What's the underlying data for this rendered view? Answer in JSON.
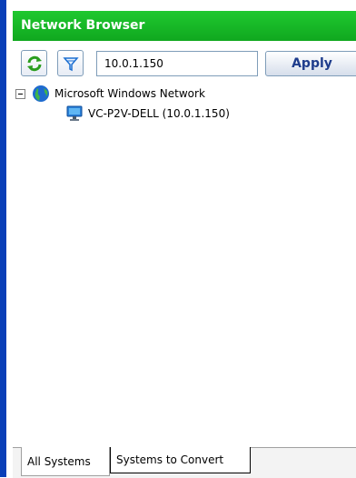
{
  "window": {
    "title": "Network Browser"
  },
  "toolbar": {
    "refresh_icon": "refresh-icon",
    "filter_icon": "filter-icon",
    "address_value": "10.0.1.150",
    "apply_label": "Apply"
  },
  "tree": {
    "root": {
      "label": "Microsoft Windows Network",
      "icon": "network-globe-icon",
      "expanded": true
    },
    "children": [
      {
        "label": "VC-P2V-DELL (10.0.1.150)",
        "icon": "computer-icon"
      }
    ]
  },
  "tabs": [
    {
      "label": "All Systems",
      "active": true
    },
    {
      "label": "Systems to Convert",
      "active": false
    }
  ],
  "colors": {
    "titlebar": "#10a81f",
    "frame": "#0a3fb8",
    "apply_text": "#1e3c8c"
  }
}
